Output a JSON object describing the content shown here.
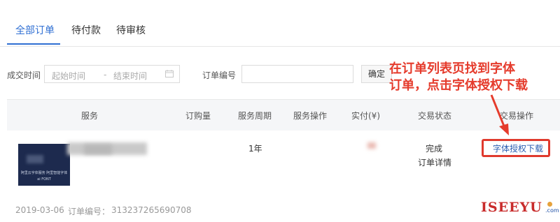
{
  "tabs": [
    {
      "label": "全部订单",
      "active": true
    },
    {
      "label": "待付款",
      "active": false
    },
    {
      "label": "待审核",
      "active": false
    }
  ],
  "filters": {
    "date_label": "成交时间",
    "start_placeholder": "起始时间",
    "separator": "-",
    "end_placeholder": "结束时间",
    "order_no_label": "订单编号",
    "order_no_value": "",
    "confirm_label": "确定"
  },
  "table": {
    "headers": [
      "服务",
      "订购量",
      "服务周期",
      "服务操作",
      "实付(¥)",
      "交易状态",
      "交易操作"
    ],
    "rows": [
      {
        "quantity": "",
        "period": "1年",
        "status": "完成",
        "detail_link": "订单详情",
        "action_link": "字体授权下载",
        "date": "2019-03-06",
        "order_no_label": "订单编号：",
        "order_no": "313237265690708",
        "thumb_caption": "阿里云字体服务 阿里智能字体",
        "thumb_brand": "ai FONT"
      }
    ]
  },
  "annotation": {
    "line1": "在订单列表页找到字体",
    "line2": "订单，点击字体授权下载",
    "color": "#e53b2c"
  },
  "watermark": {
    "text": "ISEEYU",
    "suffix": ".com"
  },
  "colors": {
    "accent": "#2f6fd3",
    "link": "#2a5db0",
    "highlight": "#e03a2e"
  }
}
